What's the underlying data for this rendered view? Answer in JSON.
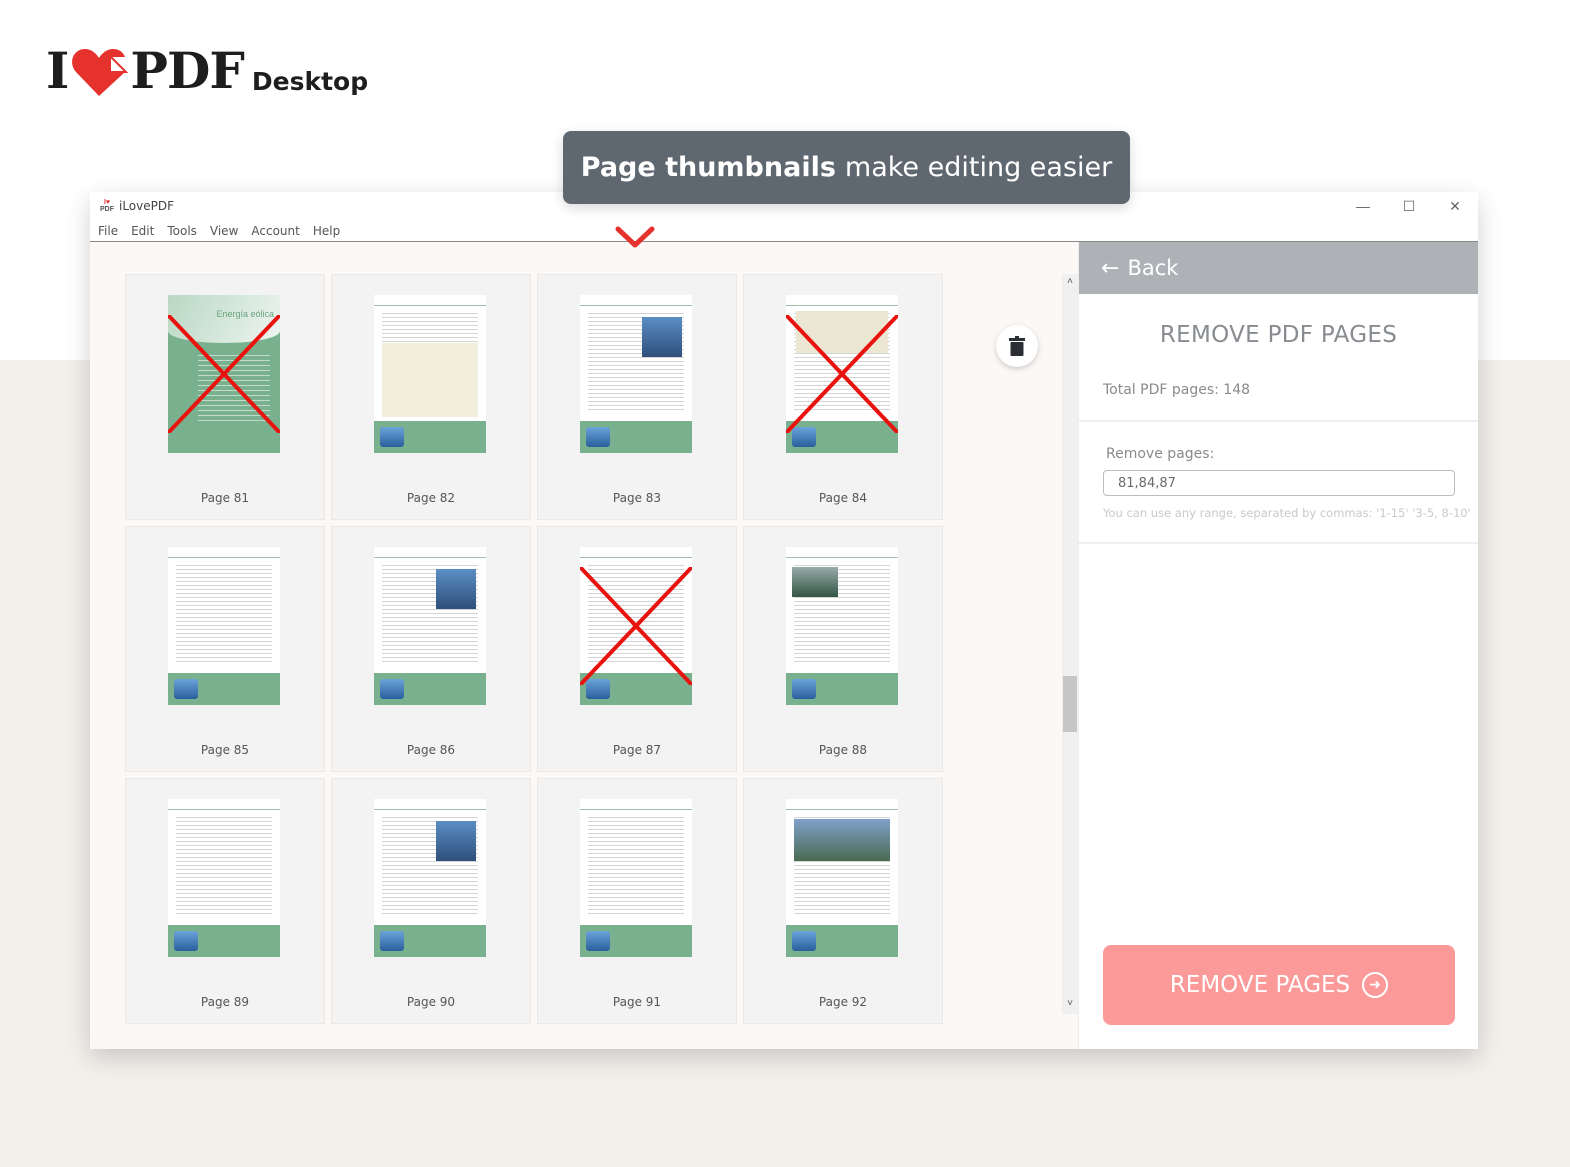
{
  "brand": {
    "logo_i": "I",
    "logo_pdf": "PDF",
    "product": "Desktop",
    "accent_color": "#e5322d"
  },
  "tooltip": {
    "bold": "Page thumbnails",
    "rest": "make editing easier"
  },
  "window": {
    "title": "iLovePDF",
    "app_icon_text_top": "I♥",
    "app_icon_text_bottom": "PDF",
    "controls": [
      "minimize-icon",
      "maximize-icon",
      "close-icon"
    ],
    "minimize_glyph": "—",
    "maximize_glyph": "☐",
    "close_glyph": "✕"
  },
  "menu": [
    "File",
    "Edit",
    "Tools",
    "View",
    "Account",
    "Help"
  ],
  "pages": [
    {
      "label": "Page 81",
      "removed": true,
      "style": "cover",
      "cover_title": "Energía eólica"
    },
    {
      "label": "Page 82",
      "removed": false,
      "style": "table"
    },
    {
      "label": "Page 83",
      "removed": false,
      "style": "image"
    },
    {
      "label": "Page 84",
      "removed": true,
      "style": "chart"
    },
    {
      "label": "Page 85",
      "removed": false,
      "style": "text"
    },
    {
      "label": "Page 86",
      "removed": false,
      "style": "image"
    },
    {
      "label": "Page 87",
      "removed": true,
      "style": "text"
    },
    {
      "label": "Page 88",
      "removed": false,
      "style": "image-left"
    },
    {
      "label": "Page 89",
      "removed": false,
      "style": "text"
    },
    {
      "label": "Page 90",
      "removed": false,
      "style": "image"
    },
    {
      "label": "Page 91",
      "removed": false,
      "style": "text"
    },
    {
      "label": "Page 92",
      "removed": false,
      "style": "banner"
    }
  ],
  "scroll": {
    "up_glyph": "˄",
    "down_glyph": "˅",
    "position_fraction": 0.56
  },
  "sidebar": {
    "back_label": "Back",
    "back_arrow": "←",
    "title": "REMOVE PDF PAGES",
    "total_pages_text": "Total PDF pages: 148",
    "remove_label": "Remove pages:",
    "remove_value": "81,84,87",
    "hint": "You can use any range, separated by commas: '1-15' '3-5, 8-10'",
    "action_label": "REMOVE PAGES",
    "action_glyph": "➜",
    "action_color": "#fb9a98"
  }
}
